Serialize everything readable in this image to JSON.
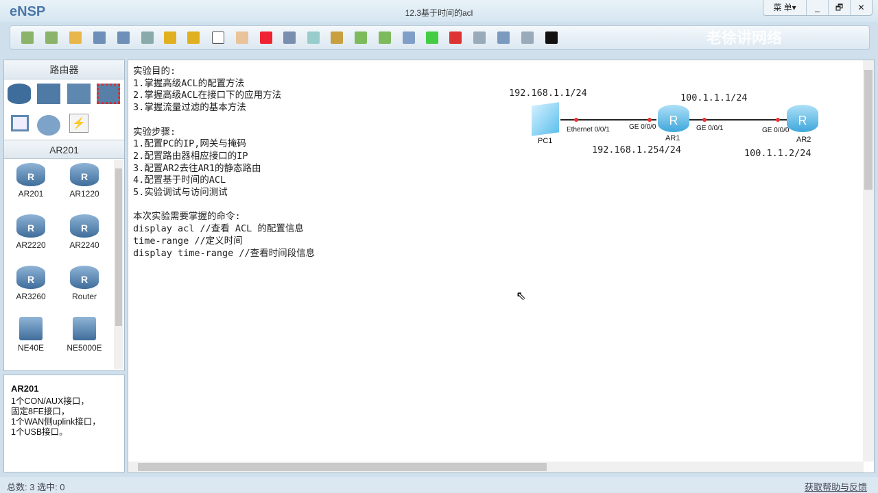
{
  "app": {
    "name": "eNSP",
    "title": "12.3基于时间的acl",
    "menu": "菜 单▾",
    "minimize": "_",
    "restore": "🗗",
    "close": "✕",
    "watermark": "老徐讲网络"
  },
  "toolbar": [
    "new-topology",
    "new-lab",
    "open",
    "save",
    "save-as",
    "print",
    "undo",
    "redo",
    "select",
    "pan",
    "delete",
    "delete-link",
    "text-note",
    "palette",
    "zoom-in",
    "zoom-out",
    "fit",
    "start-all",
    "stop-all",
    "capture",
    "topology-view",
    "grid",
    "cli"
  ],
  "left": {
    "category_title": "路由器",
    "sub_title": "AR201",
    "devices": [
      "AR201",
      "AR1220",
      "AR2220",
      "AR2240",
      "AR3260",
      "Router",
      "NE40E",
      "NE5000E"
    ],
    "desc_title": "AR201",
    "desc": [
      "1个CON/AUX接口，",
      "固定8FE接口，",
      "1个WAN侧uplink接口，",
      "1个USB接口。"
    ]
  },
  "canvas": {
    "notes": "实验目的:\n1.掌握高级ACL的配置方法\n2.掌握高级ACL在接口下的应用方法\n3.掌握流量过滤的基本方法\n\n实验步骤:\n1.配置PC的IP,网关与掩码\n2.配置路由器相应接口的IP\n3.配置AR2去往AR1的静态路由\n4.配置基于时间的ACL\n5.实验调试与访问测试\n\n本次实验需要掌握的命令:\ndisplay acl //查看 ACL 的配置信息\ntime-range //定义时间\ndisplay time-range //查看时间段信息",
    "topology": {
      "pc1": "PC1",
      "ar1": "AR1",
      "ar2": "AR2",
      "pc_ip": "192.168.1.1/24",
      "ar1_g0_ip": "192.168.1.254/24",
      "ar1_g1_ip": "100.1.1.1/24",
      "ar2_ip": "100.1.1.2/24",
      "p_pc": "Ethernet 0/0/1",
      "p_ar1_g0": "GE 0/0/0",
      "p_ar1_g1": "GE 0/0/1",
      "p_ar2": "GE 0/0/0"
    }
  },
  "status": {
    "left": "总数: 3  选中: 0",
    "right": "获取帮助与反馈"
  }
}
